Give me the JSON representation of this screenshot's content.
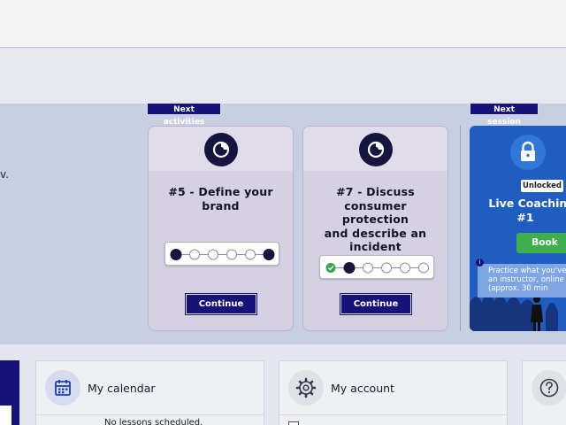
{
  "page": {
    "left_fragment": "v.",
    "next_activities_tag": "Next activities",
    "next_session_tag": "Next session"
  },
  "activities": [
    {
      "title_lines": [
        "#5 - Define your",
        "brand"
      ],
      "progress": {
        "total_steps": 6,
        "completed": 0,
        "current_steps": [
          1,
          6
        ]
      },
      "button": "Continue"
    },
    {
      "title_lines": [
        "#7 - Discuss",
        "consumer protection",
        "and describe an",
        "incident"
      ],
      "progress": {
        "total_steps": 6,
        "completed": 1,
        "current_steps": [
          2
        ]
      },
      "button": "Continue"
    }
  ],
  "session": {
    "badge": "Unlocked",
    "title_line1": "Live Coaching S",
    "title_line2": "#1",
    "book_button": "Book",
    "info_lines": [
      "Practice what you've l",
      "an instructor, online v",
      "(approx. 30 min"
    ]
  },
  "tiles": {
    "calendar": {
      "label": "My calendar",
      "sub": "No lessons scheduled."
    },
    "account": {
      "label": "My account"
    }
  },
  "colors": {
    "navy": "#15137a",
    "session_blue": "#1f5ec0",
    "book_green": "#3fae4d",
    "done_green": "#2fa84f"
  },
  "icons": [
    "target-icon",
    "lock-icon",
    "calendar-icon",
    "gear-icon",
    "help-icon",
    "check-icon"
  ]
}
